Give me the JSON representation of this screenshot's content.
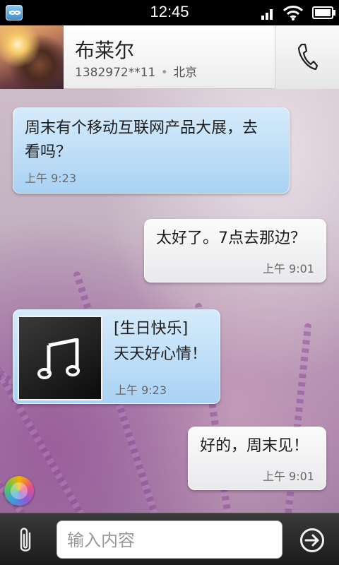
{
  "status_bar": {
    "time": "12:45"
  },
  "header": {
    "name": "布莱尔",
    "phone": "1382972**11",
    "separator": "•",
    "location": "北京"
  },
  "messages": [
    {
      "direction": "incoming",
      "text_line1": "周末有个移动互联网产品大展，去",
      "text_line2": "看吗？",
      "time": "上午 9:23"
    },
    {
      "direction": "outgoing",
      "text": "太好了。7点去那边？",
      "time": "上午 9:01"
    },
    {
      "direction": "incoming",
      "type": "music",
      "title": "[生日快乐]",
      "text": "天天好心情！",
      "time": "上午 9:23"
    },
    {
      "direction": "outgoing",
      "text": "好的，周末见！",
      "time": "上午 9:01"
    }
  ],
  "input": {
    "placeholder": "输入内容"
  },
  "icons": {
    "app": "app-logo-icon",
    "signal": "signal-icon",
    "wifi": "wifi-icon",
    "battery": "battery-icon",
    "call": "phone-icon",
    "music": "music-note-icon",
    "attach": "paperclip-icon",
    "send": "send-arrow-icon",
    "menu": "colorful-menu-icon"
  },
  "colors": {
    "incoming_bubble": "#a9d2f4",
    "outgoing_bubble": "#f2f2f4",
    "status_bar": "#000000"
  }
}
